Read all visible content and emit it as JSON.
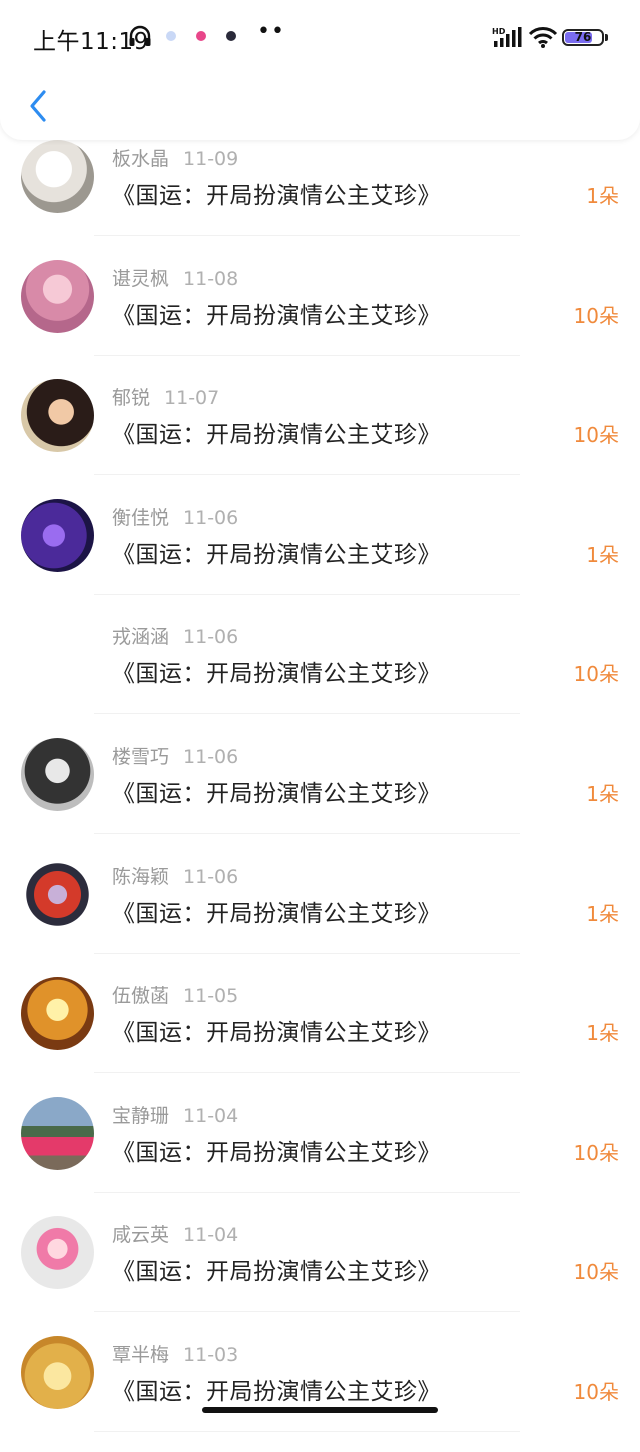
{
  "status_bar": {
    "time": "上午11:19",
    "battery": "76",
    "battery_level": 0.76,
    "notif_colors": [
      "#c9d8f6",
      "#e8468a",
      "#2a2a3a"
    ],
    "more": "••"
  },
  "colors": {
    "accent": "#2d8cf0",
    "amount": "#f08a3c",
    "name": "#9a9a9a"
  },
  "rows": [
    {
      "name": "板水晶",
      "date": "11-09",
      "book": "《国运：开局扮演情公主艾珍》",
      "amount": "1朵"
    },
    {
      "name": "谌灵枫",
      "date": "11-08",
      "book": "《国运：开局扮演情公主艾珍》",
      "amount": "10朵"
    },
    {
      "name": "郁锐",
      "date": "11-07",
      "book": "《国运：开局扮演情公主艾珍》",
      "amount": "10朵"
    },
    {
      "name": "衡佳悦",
      "date": "11-06",
      "book": "《国运：开局扮演情公主艾珍》",
      "amount": "1朵"
    },
    {
      "name": "戎涵涵",
      "date": "11-06",
      "book": "《国运：开局扮演情公主艾珍》",
      "amount": "10朵"
    },
    {
      "name": "楼雪巧",
      "date": "11-06",
      "book": "《国运：开局扮演情公主艾珍》",
      "amount": "1朵"
    },
    {
      "name": "陈海颖",
      "date": "11-06",
      "book": "《国运：开局扮演情公主艾珍》",
      "amount": "1朵"
    },
    {
      "name": "伍傲菡",
      "date": "11-05",
      "book": "《国运：开局扮演情公主艾珍》",
      "amount": "1朵"
    },
    {
      "name": "宝静珊",
      "date": "11-04",
      "book": "《国运：开局扮演情公主艾珍》",
      "amount": "10朵"
    },
    {
      "name": "咸云英",
      "date": "11-04",
      "book": "《国运：开局扮演情公主艾珍》",
      "amount": "10朵"
    },
    {
      "name": "覃半梅",
      "date": "11-03",
      "book": "《国运：开局扮演情公主艾珍》",
      "amount": "10朵"
    }
  ]
}
